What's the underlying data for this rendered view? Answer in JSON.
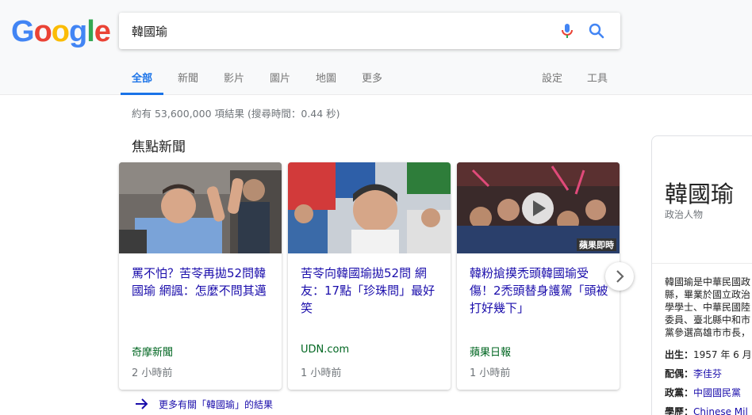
{
  "logo": {
    "letters": [
      "G",
      "o",
      "o",
      "g",
      "l",
      "e"
    ],
    "colors": [
      "#4285f4",
      "#ea4335",
      "#fbbc05",
      "#4285f4",
      "#34a853",
      "#ea4335"
    ]
  },
  "search": {
    "query": "韓國瑜",
    "mic_icon": "microphone-icon",
    "search_icon": "magnifier-icon"
  },
  "tabs": [
    "全部",
    "新聞",
    "影片",
    "圖片",
    "地圖",
    "更多"
  ],
  "tabs_right": [
    "設定",
    "工具"
  ],
  "stats": "約有 53,600,000 項結果 (搜尋時間：0.44 秒)",
  "top_stories": {
    "title": "焦點新聞",
    "cards": [
      {
        "title": "罵不怕？苦苓再拋52問韓國瑜 網諷：怎麼不問其邁",
        "source": "奇摩新聞",
        "time": "2 小時前"
      },
      {
        "title": "苦苓向韓國瑜拋52問 網友：17點「珍珠問」最好笑",
        "source": "UDN.com",
        "time": "1 小時前"
      },
      {
        "title": "韓粉搶摸禿頭韓國瑜受傷！2禿頭替身護駕「頭被打好幾下」",
        "source": "蘋果日報",
        "time": "1 小時前",
        "image_caption": "蘋果即時"
      }
    ],
    "more": "更多有關「韓國瑜」的結果"
  },
  "knowledge_panel": {
    "title": "韓國瑜",
    "subtitle": "政治人物",
    "description_lines": [
      "韓國瑜是中華民國政",
      "縣，畢業於國立政治",
      "學學士、中華民國陸",
      "委員、臺北縣中和市",
      "黨參選高雄市市長，"
    ],
    "facts": [
      {
        "key": "出生：",
        "value": "1957 年 6 月",
        "link": false
      },
      {
        "key": "配偶：",
        "value": "李佳芬",
        "link": true
      },
      {
        "key": "政黨：",
        "value": "中國國民黨",
        "link": true
      },
      {
        "key": "學歷：",
        "value": "Chinese Mil",
        "link": true
      }
    ]
  },
  "colors": {
    "accent": "#1a73e8",
    "link": "#1a0dab",
    "source_green": "#006621"
  }
}
